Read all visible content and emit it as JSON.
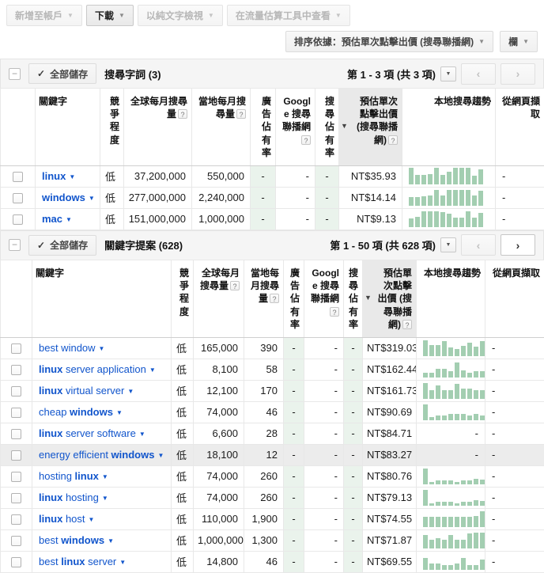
{
  "colors": {
    "link": "#1155cc",
    "spark": "#a3ceb1",
    "greencol": "#eaf3ec",
    "sortbg": "#e9e9e9",
    "hl": "#ececec"
  },
  "toolbar": {
    "add_to_account": "新增至帳戶",
    "download": "下載",
    "view_as_text": "以純文字檢視",
    "view_in_traffic_estimator": "在流量估算工具中查看",
    "sort_by": "排序依據：預估單次點擊出價 (搜尋聯播網)",
    "columns": "欄"
  },
  "competition_low": "低",
  "sections": [
    {
      "save_all": "全部儲存",
      "title": "搜尋字詞 (3)",
      "pagination": "第 1 - 3 項 (共 3 項)",
      "prev_enabled": false,
      "next_enabled": false,
      "columns": [
        {
          "id": "keyword",
          "label": "關鍵字",
          "align": "left"
        },
        {
          "id": "competition",
          "label": "競爭程度"
        },
        {
          "id": "global-monthly-searches",
          "label": "全球每月搜尋量",
          "help": true
        },
        {
          "id": "local-monthly-searches",
          "label": "當地每月搜尋量",
          "help": true
        },
        {
          "id": "ad-share",
          "label": "廣告佔有率"
        },
        {
          "id": "google-search-network",
          "label": "Google 搜尋聯播網",
          "help": true
        },
        {
          "id": "search-share",
          "label": "搜尋佔有率"
        },
        {
          "id": "estimated-cpc",
          "label": "預估單次點擊出價 (搜尋聯播網)",
          "help": true,
          "sorted": true
        },
        {
          "id": "local-search-trends",
          "label": "本地搜尋趨勢"
        },
        {
          "id": "extracted-from-webpage",
          "label": "從網頁擷取"
        }
      ],
      "rows": [
        {
          "keyword": [
            {
              "text": "linux",
              "bold": true
            }
          ],
          "competition": "低",
          "global": "37,200,000",
          "local": "550,000",
          "ad_share": "-",
          "google_net": "-",
          "search_share": "-",
          "cpc": "NT$35.93",
          "trend": [
            1,
            0.55,
            0.55,
            0.6,
            1,
            0.55,
            0.75,
            1,
            1,
            1,
            0.5,
            0.9
          ],
          "extracted": "-"
        },
        {
          "keyword": [
            {
              "text": "windows",
              "bold": true
            }
          ],
          "competition": "低",
          "global": "277,000,000",
          "local": "2,240,000",
          "ad_share": "-",
          "google_net": "-",
          "search_share": "-",
          "cpc": "NT$14.14",
          "trend": [
            0.5,
            0.5,
            0.55,
            0.6,
            0.95,
            0.6,
            0.95,
            0.95,
            0.95,
            0.95,
            0.6,
            0.9
          ],
          "extracted": "-"
        },
        {
          "keyword": [
            {
              "text": "mac",
              "bold": true
            }
          ],
          "competition": "低",
          "global": "151,000,000",
          "local": "1,000,000",
          "ad_share": "-",
          "google_net": "-",
          "search_share": "-",
          "cpc": "NT$9.13",
          "trend": [
            0.5,
            0.6,
            0.95,
            0.95,
            0.95,
            0.9,
            0.8,
            0.55,
            0.55,
            0.95,
            0.55,
            0.85
          ],
          "extracted": "-"
        }
      ]
    },
    {
      "save_all": "全部儲存",
      "title": "關鍵字提案 (628)",
      "pagination": "第 1 - 50 項 (共 628 項)",
      "prev_enabled": false,
      "next_enabled": true,
      "columns": [
        {
          "id": "keyword",
          "label": "關鍵字",
          "align": "left"
        },
        {
          "id": "competition",
          "label": "競爭程度"
        },
        {
          "id": "global-monthly-searches",
          "label": "全球每月搜尋量",
          "help": true
        },
        {
          "id": "local-monthly-searches",
          "label": "當地每月搜尋量",
          "help": true
        },
        {
          "id": "ad-share",
          "label": "廣告佔有率"
        },
        {
          "id": "google-search-network",
          "label": "Google 搜尋聯播網",
          "help": true
        },
        {
          "id": "search-share",
          "label": "搜尋佔有率"
        },
        {
          "id": "estimated-cpc",
          "label": "預估單次點擊出價 (搜尋聯播網)",
          "help": true,
          "sorted": true
        },
        {
          "id": "local-search-trends",
          "label": "本地搜尋趨勢"
        },
        {
          "id": "extracted-from-webpage",
          "label": "從網頁擷取"
        }
      ],
      "rows": [
        {
          "keyword": [
            {
              "text": "best window",
              "bold": false
            }
          ],
          "competition": "低",
          "global": "165,000",
          "local": "390",
          "ad_share": "-",
          "google_net": "-",
          "search_share": "-",
          "cpc": "NT$319.03",
          "trend": [
            0.95,
            0.65,
            0.65,
            0.9,
            0.5,
            0.45,
            0.6,
            0.8,
            0.55,
            0.9,
            0.6,
            0.8
          ],
          "extracted": "-"
        },
        {
          "keyword": [
            {
              "text": "linux",
              "bold": true
            },
            {
              "text": " server application",
              "bold": false
            }
          ],
          "competition": "低",
          "global": "8,100",
          "local": "58",
          "ad_share": "-",
          "google_net": "-",
          "search_share": "-",
          "cpc": "NT$162.44",
          "trend": [
            0.3,
            0.3,
            0.5,
            0.5,
            0.4,
            0.9,
            0.45,
            0.3,
            0.4,
            0.4,
            0.3,
            0.85
          ],
          "extracted": "-"
        },
        {
          "keyword": [
            {
              "text": "linux",
              "bold": true
            },
            {
              "text": " virtual server",
              "bold": false
            }
          ],
          "competition": "低",
          "global": "12,100",
          "local": "170",
          "ad_share": "-",
          "google_net": "-",
          "search_share": "-",
          "cpc": "NT$161.73",
          "trend": [
            0.95,
            0.5,
            0.8,
            0.5,
            0.5,
            0.9,
            0.6,
            0.6,
            0.5,
            0.5,
            0.2,
            0.5
          ],
          "extracted": "-"
        },
        {
          "keyword": [
            {
              "text": "cheap ",
              "bold": false
            },
            {
              "text": "windows",
              "bold": true
            }
          ],
          "competition": "低",
          "global": "74,000",
          "local": "46",
          "ad_share": "-",
          "google_net": "-",
          "search_share": "-",
          "cpc": "NT$90.69",
          "trend": [
            0.95,
            0.2,
            0.3,
            0.3,
            0.4,
            0.4,
            0.4,
            0.3,
            0.4,
            0.3,
            0.6,
            0.6
          ],
          "extracted": "-"
        },
        {
          "keyword": [
            {
              "text": "linux",
              "bold": true
            },
            {
              "text": " server software",
              "bold": false
            }
          ],
          "competition": "低",
          "global": "6,600",
          "local": "28",
          "ad_share": "-",
          "google_net": "-",
          "search_share": "-",
          "cpc": "NT$84.71",
          "trend": null,
          "extracted": "-"
        },
        {
          "keyword": [
            {
              "text": "energy efficient ",
              "bold": false
            },
            {
              "text": "windows",
              "bold": true
            }
          ],
          "competition": "低",
          "global": "18,100",
          "local": "12",
          "ad_share": "-",
          "google_net": "-",
          "search_share": "-",
          "cpc": "NT$83.27",
          "trend": null,
          "extracted": "-",
          "highlighted": true
        },
        {
          "keyword": [
            {
              "text": "hosting ",
              "bold": false
            },
            {
              "text": "linux",
              "bold": true
            }
          ],
          "competition": "低",
          "global": "74,000",
          "local": "260",
          "ad_share": "-",
          "google_net": "-",
          "search_share": "-",
          "cpc": "NT$80.76",
          "trend": [
            0.95,
            0.15,
            0.25,
            0.25,
            0.25,
            0.15,
            0.25,
            0.25,
            0.35,
            0.3,
            0.15,
            0.25
          ],
          "extracted": "-"
        },
        {
          "keyword": [
            {
              "text": "linux",
              "bold": true
            },
            {
              "text": " hosting",
              "bold": false
            }
          ],
          "competition": "低",
          "global": "74,000",
          "local": "260",
          "ad_share": "-",
          "google_net": "-",
          "search_share": "-",
          "cpc": "NT$79.13",
          "trend": [
            0.95,
            0.15,
            0.25,
            0.25,
            0.25,
            0.15,
            0.25,
            0.25,
            0.35,
            0.3,
            0.15,
            0.25
          ],
          "extracted": "-"
        },
        {
          "keyword": [
            {
              "text": "linux",
              "bold": true
            },
            {
              "text": " host",
              "bold": false
            }
          ],
          "competition": "低",
          "global": "110,000",
          "local": "1,900",
          "ad_share": "-",
          "google_net": "-",
          "search_share": "-",
          "cpc": "NT$74.55",
          "trend": [
            0.6,
            0.6,
            0.6,
            0.6,
            0.6,
            0.6,
            0.6,
            0.6,
            0.65,
            0.95,
            0.5,
            0.7
          ],
          "extracted": "-"
        },
        {
          "keyword": [
            {
              "text": "best ",
              "bold": false
            },
            {
              "text": "windows",
              "bold": true
            }
          ],
          "competition": "低",
          "global": "1,000,000",
          "local": "1,300",
          "ad_share": "-",
          "google_net": "-",
          "search_share": "-",
          "cpc": "NT$71.87",
          "trend": [
            0.8,
            0.5,
            0.6,
            0.5,
            0.8,
            0.5,
            0.5,
            0.9,
            0.95,
            0.95,
            0.8,
            0.6
          ],
          "extracted": "-"
        },
        {
          "keyword": [
            {
              "text": "best ",
              "bold": false
            },
            {
              "text": "linux",
              "bold": true
            },
            {
              "text": " server",
              "bold": false
            }
          ],
          "competition": "低",
          "global": "14,800",
          "local": "46",
          "ad_share": "-",
          "google_net": "-",
          "search_share": "-",
          "cpc": "NT$69.55",
          "trend": [
            0.7,
            0.4,
            0.4,
            0.3,
            0.3,
            0.4,
            0.7,
            0.3,
            0.3,
            0.6,
            0.5,
            0.95
          ],
          "extracted": "-"
        }
      ]
    }
  ]
}
